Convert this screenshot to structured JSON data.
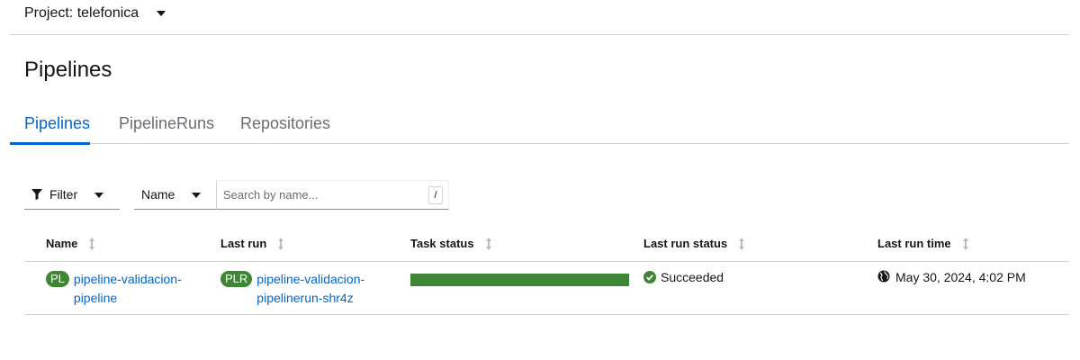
{
  "project": {
    "label": "Project: telefonica"
  },
  "page": {
    "title": "Pipelines"
  },
  "tabs": [
    {
      "label": "Pipelines",
      "active": true
    },
    {
      "label": "PipelineRuns",
      "active": false
    },
    {
      "label": "Repositories",
      "active": false
    }
  ],
  "toolbar": {
    "filter_label": "Filter",
    "name_select": "Name",
    "search_placeholder": "Search by name...",
    "shortcut": "/"
  },
  "table": {
    "columns": [
      "Name",
      "Last run",
      "Task status",
      "Last run status",
      "Last run time"
    ],
    "rows": [
      {
        "name_badge": "PL",
        "name_line1": "pipeline-validacion-",
        "name_line2": "pipeline",
        "run_badge": "PLR",
        "run_line1": "pipeline-validacion-",
        "run_line2": "pipelinerun-shr4z",
        "task_status_fraction": 1.0,
        "status": "Succeeded",
        "time": "May 30, 2024, 4:02 PM"
      }
    ]
  },
  "colors": {
    "accent": "#0066cc",
    "success": "#3e8635",
    "border": "#d2d2d2"
  }
}
